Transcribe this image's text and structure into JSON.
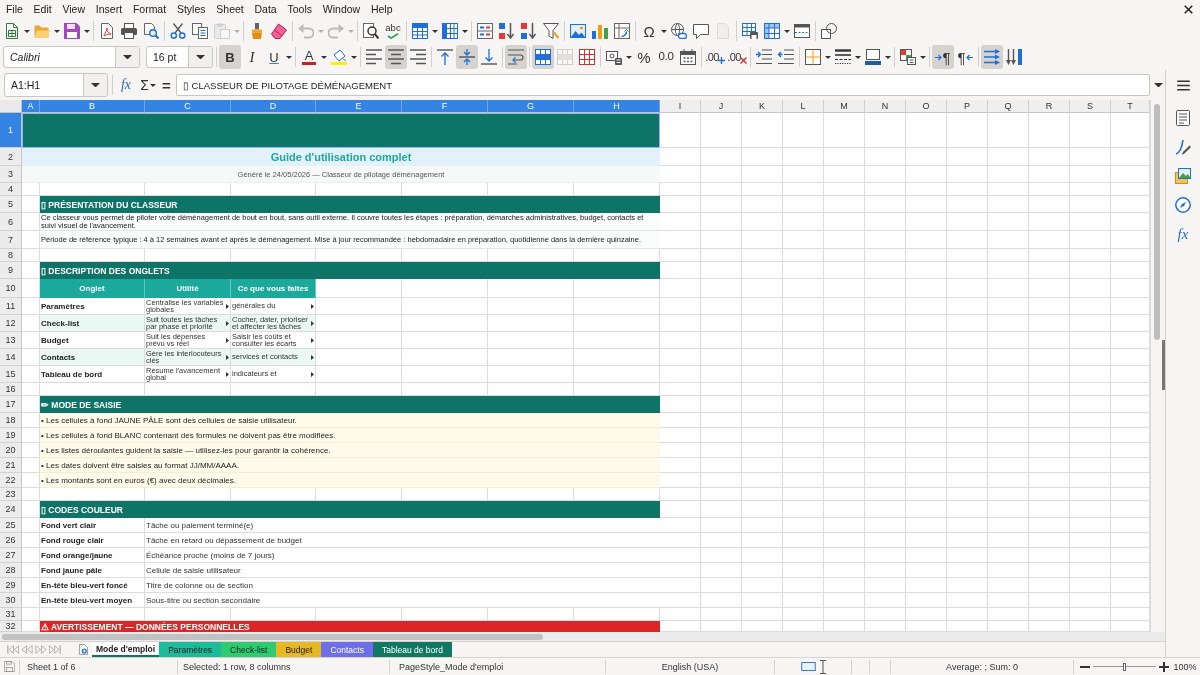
{
  "menu_bar": {
    "items": [
      "File",
      "Edit",
      "View",
      "Insert",
      "Format",
      "Styles",
      "Sheet",
      "Data",
      "Tools",
      "Window",
      "Help"
    ]
  },
  "standard_toolbar": {
    "groups": [
      [
        {
          "kind": "new",
          "arrow": true,
          "disabled": false
        },
        {
          "kind": "open",
          "arrow": true,
          "disabled": false
        },
        {
          "kind": "save",
          "arrow": true,
          "disabled": false
        }
      ],
      [
        {
          "kind": "pdf",
          "disabled": false
        },
        {
          "kind": "print",
          "disabled": false
        },
        {
          "kind": "preview",
          "disabled": false
        }
      ],
      [
        {
          "kind": "cut",
          "disabled": false
        },
        {
          "kind": "copy",
          "disabled": false
        },
        {
          "kind": "paste",
          "arrow": true,
          "disabled": true
        }
      ],
      [
        {
          "kind": "brush",
          "disabled": false
        },
        {
          "kind": "eraser",
          "disabled": false
        }
      ],
      [
        {
          "kind": "undo",
          "arrow": true,
          "disabled": true
        },
        {
          "kind": "redo",
          "arrow": true,
          "disabled": true
        }
      ],
      [
        {
          "kind": "find",
          "disabled": false
        },
        {
          "kind": "spelling",
          "label": "abc",
          "disabled": false
        }
      ],
      [
        {
          "kind": "row",
          "arrow": true,
          "disabled": false
        },
        {
          "kind": "column",
          "arrow": true,
          "disabled": false
        }
      ],
      [
        {
          "kind": "sort",
          "disabled": false
        },
        {
          "kind": "ascending",
          "disabled": false
        },
        {
          "kind": "descending",
          "disabled": false
        },
        {
          "kind": "filter",
          "disabled": false
        }
      ],
      [
        {
          "kind": "image",
          "disabled": false
        },
        {
          "kind": "chart",
          "disabled": false
        },
        {
          "kind": "pivot",
          "disabled": false
        }
      ],
      [
        {
          "kind": "symbol",
          "label": "Ω",
          "arrow": true,
          "disabled": false
        },
        {
          "kind": "link",
          "disabled": false
        },
        {
          "kind": "comment",
          "disabled": false
        },
        {
          "kind": "page",
          "disabled": true
        }
      ],
      [
        {
          "kind": "printarea",
          "disabled": false
        },
        {
          "kind": "freeze",
          "arrow": true,
          "disabled": false
        },
        {
          "kind": "split",
          "disabled": false
        }
      ],
      [
        {
          "kind": "shapes",
          "disabled": false
        }
      ]
    ]
  },
  "formatting_toolbar": {
    "font_name": "Calibri",
    "font_size": "16 pt",
    "groups": [
      [
        {
          "kind": "bold",
          "label": "B",
          "on": true,
          "disabled": false
        },
        {
          "kind": "italic",
          "label": "I",
          "on": false,
          "disabled": false
        },
        {
          "kind": "underline",
          "label": "U",
          "arrow": true,
          "on": false,
          "disabled": false
        }
      ],
      [
        {
          "kind": "fontcolor",
          "label": "A",
          "arrow": true,
          "on": false,
          "disabled": false
        },
        {
          "kind": "highlight",
          "arrow": true,
          "on": false,
          "disabled": false
        }
      ],
      [
        {
          "kind": "left",
          "on": false,
          "disabled": false
        },
        {
          "kind": "center",
          "on": true,
          "disabled": false
        },
        {
          "kind": "right",
          "on": false,
          "disabled": false
        }
      ],
      [
        {
          "kind": "top",
          "on": false,
          "disabled": false
        },
        {
          "kind": "middle",
          "on": true,
          "disabled": false
        },
        {
          "kind": "bottom",
          "on": false,
          "disabled": false
        }
      ],
      [
        {
          "kind": "wrap",
          "on": true,
          "disabled": false
        }
      ],
      [
        {
          "kind": "mergecenter",
          "on": true,
          "disabled": false
        },
        {
          "kind": "merge",
          "on": false,
          "disabled": true
        },
        {
          "kind": "unmerge",
          "on": false,
          "disabled": false
        }
      ],
      [
        {
          "kind": "currency",
          "arrow": true,
          "on": false,
          "disabled": false
        },
        {
          "kind": "percent",
          "label": "%",
          "on": false,
          "disabled": false
        },
        {
          "kind": "standard",
          "label": "0.0",
          "on": false,
          "disabled": false
        },
        {
          "kind": "date",
          "on": false,
          "disabled": false
        }
      ],
      [
        {
          "kind": "adddecimal",
          "label": ".00",
          "on": false,
          "disabled": false
        },
        {
          "kind": "deletedecimal",
          "label": ".00",
          "on": false,
          "disabled": false
        }
      ],
      [
        {
          "kind": "indent",
          "on": false,
          "disabled": false
        },
        {
          "kind": "outdent",
          "on": false,
          "disabled": false
        }
      ],
      [
        {
          "kind": "borders",
          "arrow": true,
          "on": false,
          "disabled": false
        },
        {
          "kind": "borderstyle",
          "arrow": true,
          "on": false,
          "disabled": false
        },
        {
          "kind": "bordercolor",
          "arrow": true,
          "on": false,
          "disabled": false
        }
      ],
      [
        {
          "kind": "conditional",
          "arrow": true,
          "on": false,
          "disabled": false
        }
      ],
      [
        {
          "kind": "ltr",
          "label": "¶",
          "on": true,
          "disabled": false
        },
        {
          "kind": "rtl",
          "label": "¶",
          "on": false,
          "disabled": false
        }
      ],
      [
        {
          "kind": "horizontal",
          "on": true,
          "disabled": false
        },
        {
          "kind": "vertical",
          "on": false,
          "disabled": false
        }
      ]
    ]
  },
  "formula_bar": {
    "name_box": "A1:H1",
    "function_wizard": "fx",
    "sum": "Σ",
    "formula_sign": "=",
    "formula": "▯ CLASSEUR DE PILOTAGE DÉMÉNAGEMENT"
  },
  "sidebar": {
    "tabs": [
      {
        "kind": "properties",
        "selected": false
      },
      {
        "kind": "styles",
        "selected": false
      },
      {
        "kind": "gallery",
        "selected": false
      },
      {
        "kind": "navigator",
        "selected": false
      },
      {
        "kind": "functions",
        "label": "fx",
        "selected": false
      }
    ]
  },
  "sheet": {
    "columns": [
      {
        "label": "A",
        "selected": true
      },
      {
        "label": "B",
        "selected": true
      },
      {
        "label": "C",
        "selected": true
      },
      {
        "label": "D",
        "selected": true
      },
      {
        "label": "E",
        "selected": true
      },
      {
        "label": "F",
        "selected": true
      },
      {
        "label": "G",
        "selected": true
      },
      {
        "label": "H",
        "selected": true
      },
      {
        "label": "I",
        "selected": false
      },
      {
        "label": "J",
        "selected": false
      },
      {
        "label": "K",
        "selected": false
      },
      {
        "label": "L",
        "selected": false
      },
      {
        "label": "M",
        "selected": false
      },
      {
        "label": "N",
        "selected": false
      },
      {
        "label": "O",
        "selected": false
      },
      {
        "label": "P",
        "selected": false
      },
      {
        "label": "Q",
        "selected": false
      },
      {
        "label": "R",
        "selected": false
      },
      {
        "label": "S",
        "selected": false
      },
      {
        "label": "T",
        "selected": false
      }
    ],
    "rows": [
      {
        "number": "1",
        "selected": true,
        "kind": "banner"
      },
      {
        "number": "2",
        "selected": false,
        "kind": "subtitle",
        "text": "Guide d'utilisation complet"
      },
      {
        "number": "3",
        "selected": false,
        "kind": "caption",
        "text": "Généré le 24/05/2026 — Classeur de pilotage déménagement"
      },
      {
        "number": "4",
        "selected": false,
        "kind": "empty"
      },
      {
        "number": "5",
        "selected": false,
        "kind": "section",
        "text": "▯ PRÉSENTATION DU CLASSEUR"
      },
      {
        "number": "6",
        "selected": false,
        "kind": "paragraph",
        "text": "Ce classeur vous permet de piloter votre déménagement de bout en bout, sans outil externe. Il couvre toutes les étapes : préparation, démarches administratives, budget, contacts et suivi visuel de l'avancement."
      },
      {
        "number": "7",
        "selected": false,
        "kind": "paragraph",
        "text": "Période de référence typique : 4 à 12 semaines avant et après le déménagement. Mise à jour recommandée : hebdomadaire en préparation, quotidienne dans la dernière quinzaine."
      },
      {
        "number": "8",
        "selected": false,
        "kind": "empty"
      },
      {
        "number": "9",
        "selected": false,
        "kind": "section",
        "text": "▯ DESCRIPTION DES ONGLETS"
      },
      {
        "number": "10",
        "selected": false,
        "kind": "table_header",
        "cells": [
          "Onglet",
          "Utilité",
          "Ce que vous faites"
        ]
      },
      {
        "number": "11",
        "selected": false,
        "kind": "table_row",
        "cells": [
          {
            "text": "Paramètres",
            "clipped": false
          },
          {
            "text": "Centralise les variables globales",
            "clipped": true
          },
          {
            "text": "générales du",
            "clipped": true
          }
        ]
      },
      {
        "number": "12",
        "selected": false,
        "kind": "table_row",
        "cells": [
          {
            "text": "Check-list",
            "clipped": false
          },
          {
            "text": "Suit toutes les tâches par phase et priorité",
            "clipped": true
          },
          {
            "text": "Cocher, dater, prioriser et affecter les tâches",
            "clipped": true
          }
        ]
      },
      {
        "number": "13",
        "selected": false,
        "kind": "table_row",
        "cells": [
          {
            "text": "Budget",
            "clipped": false
          },
          {
            "text": "Suit les dépenses prévu vs réel",
            "clipped": true
          },
          {
            "text": "Saisir les coûts et consulter les écarts",
            "clipped": true
          }
        ]
      },
      {
        "number": "14",
        "selected": false,
        "kind": "table_row",
        "cells": [
          {
            "text": "Contacts",
            "clipped": false
          },
          {
            "text": "Gère les interlocuteurs clés",
            "clipped": true
          },
          {
            "text": "services et contacts",
            "clipped": true
          }
        ]
      },
      {
        "number": "15",
        "selected": false,
        "kind": "table_row",
        "cells": [
          {
            "text": "Tableau de bord",
            "clipped": false
          },
          {
            "text": "Résume l'avancement global",
            "clipped": true
          },
          {
            "text": "indicateurs et",
            "clipped": true
          }
        ]
      },
      {
        "number": "16",
        "selected": false,
        "kind": "empty"
      },
      {
        "number": "17",
        "selected": false,
        "kind": "section",
        "text": "✏ MODE DE SAISIE"
      },
      {
        "number": "18",
        "selected": false,
        "kind": "bullet",
        "text": "• Les cellules à fond JAUNE PÂLE sont des cellules de saisie utilisateur."
      },
      {
        "number": "19",
        "selected": false,
        "kind": "bullet",
        "text": "• Les cellules à fond BLANC contenant des formules ne doivent pas être modifiées."
      },
      {
        "number": "20",
        "selected": false,
        "kind": "bullet",
        "text": "• Les listes déroulantes guident la saisie — utilisez-les pour garantir la cohérence."
      },
      {
        "number": "21",
        "selected": false,
        "kind": "bullet",
        "text": "• Les dates doivent être saisies au format JJ/MM/AAAA."
      },
      {
        "number": "22",
        "selected": false,
        "kind": "bullet",
        "text": "• Les montants sont en euros (€) avec deux décimales."
      },
      {
        "number": "23",
        "selected": false,
        "kind": "empty"
      },
      {
        "number": "24",
        "selected": false,
        "kind": "section",
        "text": "▯ CODES COULEUR"
      },
      {
        "number": "25",
        "selected": false,
        "kind": "legend",
        "cells": [
          "Fond vert clair",
          "Tâche ou paiement terminé(e)"
        ]
      },
      {
        "number": "26",
        "selected": false,
        "kind": "legend",
        "cells": [
          "Fond rouge clair",
          "Tâche en retard ou dépassement de budget"
        ]
      },
      {
        "number": "27",
        "selected": false,
        "kind": "legend",
        "cells": [
          "Fond orange/jaune",
          "Échéance proche (moins de 7 jours)"
        ]
      },
      {
        "number": "28",
        "selected": false,
        "kind": "legend",
        "cells": [
          "Fond jaune pâle",
          "Cellule de saisie utilisateur"
        ]
      },
      {
        "number": "29",
        "selected": false,
        "kind": "legend",
        "cells": [
          "En-tête bleu-vert foncé",
          "Titre de colonne ou de section"
        ]
      },
      {
        "number": "30",
        "selected": false,
        "kind": "legend",
        "cells": [
          "En-tête bleu-vert moyen",
          "Sous-titre ou section secondaire"
        ]
      },
      {
        "number": "31",
        "selected": false,
        "kind": "empty"
      },
      {
        "number": "32",
        "selected": false,
        "kind": "warning",
        "text": "⚠ AVERTISSEMENT — DONNÉES PERSONNELLES"
      }
    ]
  },
  "sheet_tabs": {
    "navigation_disabled": true,
    "tabs": [
      {
        "label": "Mode d'emploi",
        "selected": true,
        "color": "#0f7468"
      },
      {
        "label": "Paramètres",
        "selected": false,
        "color": "#1abc9c"
      },
      {
        "label": "Check-list",
        "selected": false,
        "color": "#2ecc71"
      },
      {
        "label": "Budget",
        "selected": false,
        "color": "#e5b824"
      },
      {
        "label": "Contacts",
        "selected": false,
        "color": "#6e6eeb"
      },
      {
        "label": "Tableau de bord",
        "selected": false,
        "color": "#117864"
      }
    ]
  },
  "status_bar": {
    "sheet": "Sheet 1 of 6",
    "selection": "Selected: 1 row, 8 columns",
    "page_style": "PageStyle_Mode d'emploi",
    "language": "English (USA)",
    "summary": "Average: ; Sum: 0",
    "zoom_slider": {
      "level": 0.5
    },
    "zoom": "100%"
  }
}
